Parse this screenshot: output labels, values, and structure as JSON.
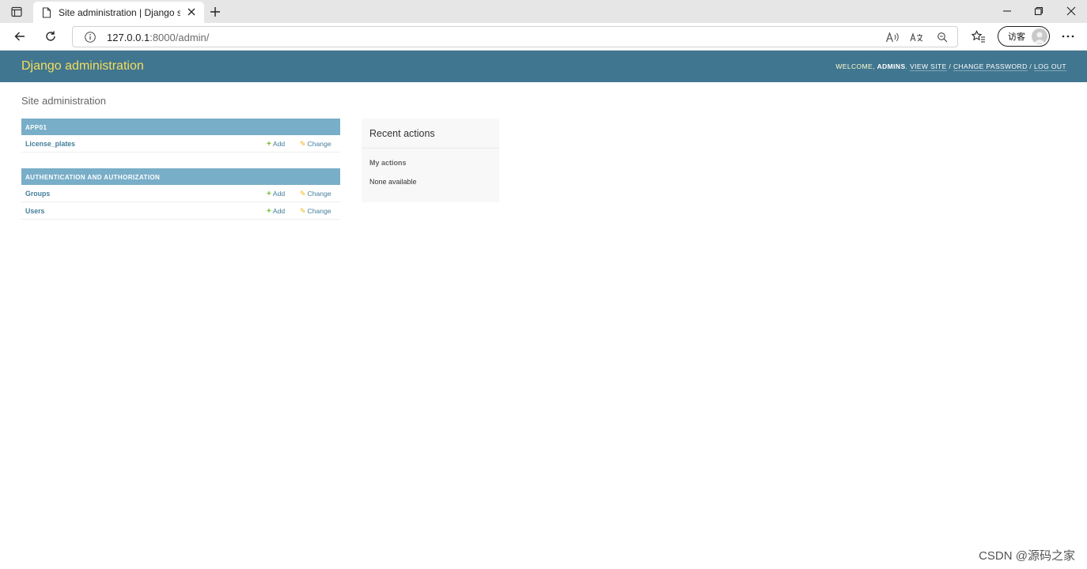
{
  "browser": {
    "tab_title": "Site administration | Django site admin",
    "url_host": "127.0.0.1",
    "url_rest": ":8000/admin/",
    "guest_label": "访客"
  },
  "header": {
    "branding": "Django administration",
    "welcome": "WELCOME,",
    "username": "ADMINS",
    "view_site": "VIEW SITE",
    "change_password": "CHANGE PASSWORD",
    "log_out": "LOG OUT"
  },
  "page": {
    "title": "Site administration"
  },
  "apps": [
    {
      "name": "APP01",
      "models": [
        {
          "name": "License_plates",
          "add": "Add",
          "change": "Change"
        }
      ]
    },
    {
      "name": "AUTHENTICATION AND AUTHORIZATION",
      "models": [
        {
          "name": "Groups",
          "add": "Add",
          "change": "Change"
        },
        {
          "name": "Users",
          "add": "Add",
          "change": "Change"
        }
      ]
    }
  ],
  "recent": {
    "title": "Recent actions",
    "my_actions": "My actions",
    "none": "None available"
  },
  "watermark": "CSDN @源码之家",
  "colors": {
    "header_bg": "#417690",
    "branding": "#f5dd5d",
    "caption_bg": "#79aec8",
    "link": "#447e9b",
    "add_icon": "#70bf2b",
    "change_icon": "#efb80b"
  }
}
